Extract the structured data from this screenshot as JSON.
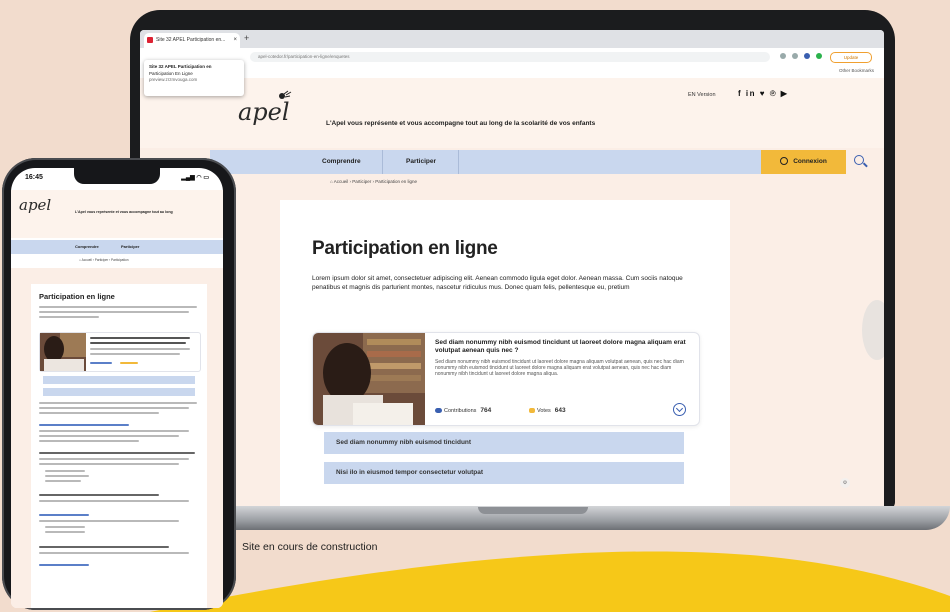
{
  "caption": "Site en cours de construction",
  "browser": {
    "tab_title": "Site 32 APEL Participation en...",
    "tab_close": "×",
    "new_tab": "+",
    "url": "apel-cotedor.fr/participation-en-ligne/enquetes",
    "update_label": "Update",
    "other_bookmarks": "Other Bookmarks",
    "tooltip": {
      "line1": "Site 32 APEL Participation en",
      "line2": "Participation En Ligne",
      "line3": "preview.zrzmvouga.com"
    }
  },
  "site": {
    "logo": "apel",
    "tagline": "L'Apel vous représente et vous accompagne tout au long de la scolarité de vos enfants",
    "top_right_link": "EN Version",
    "socials": "f in ♥ ℗ ▶",
    "nav": {
      "comprendre": "Comprendre",
      "participer": "Participer",
      "connexion": "Connexion"
    },
    "breadcrumb": "⌂  Accueil  ›  Participer  ›  Participation en ligne",
    "title": "Participation en ligne",
    "intro": "Lorem ipsum dolor sit amet, consectetuer adipiscing elit. Aenean commodo ligula eget dolor. Aenean massa. Cum sociis natoque penatibus et magnis dis parturient montes, nascetur ridiculus mus. Donec quam felis, pellentesque eu, pretium",
    "item": {
      "title": "Sed diam nonummy nibh euismod tincidunt ut laoreet dolore magna aliquam erat volutpat aenean quis nec ?",
      "description": "Sed diam nonummy nibh euismod tincidunt ut laoreet dolore magna aliquam volutpat aenean, quis nec hac diam nonummy nibh euismod tincidunt ut laoreet dolore magna aliquam erat volutpat aenean, quis nec hac diam nonummy nibh tincidunt ut laoreet dolore magna aliqua.",
      "contributions_label": "Contributions",
      "contributions_value": "764",
      "votes_label": "Votes",
      "votes_value": "643"
    },
    "subitems": [
      "Sed diam nonummy nibh euismod tincidunt",
      "Nisi ilo in eiusmod tempor consectetur volutpat"
    ]
  },
  "phone": {
    "time": "16:45",
    "status": "▂▄▆ ◠ ▭",
    "logo": "apel",
    "tagline": "L'Apel vous représente et vous accompagne tout au long",
    "nav_comprendre": "Comprendre",
    "nav_participer": "Participer",
    "breadcrumb": "⌂  Accueil  ›  Participer  ›  Participation",
    "title": "Participation en ligne"
  },
  "colors": {
    "background": "#f2dccd",
    "wave": "#f6c818",
    "nav_blue": "#c9d7ee",
    "accent_yellow": "#f2b93a",
    "accent_blue": "#3a5fb0"
  }
}
